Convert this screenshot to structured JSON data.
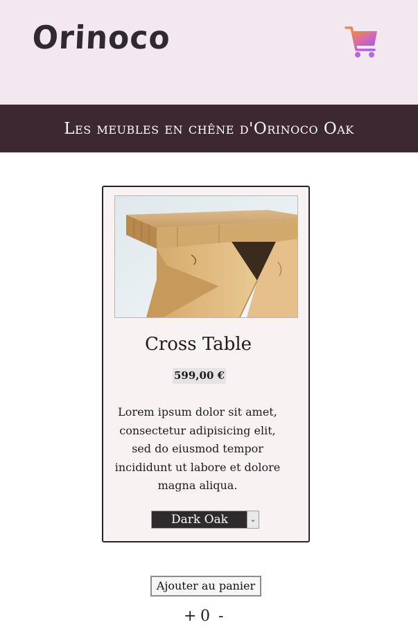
{
  "header": {
    "logo_text": "Orinoco",
    "cart_icon": "shopping-cart-icon",
    "background": "#f3e8f0"
  },
  "banner": {
    "text": "Les meubles en chêne d'Orinoco Oak",
    "background": "#3d2832"
  },
  "product": {
    "image_icon": "oak-table-photo",
    "name": "Cross Table",
    "price": "599,00 €",
    "description": "Lorem ipsum dolor sit amet, consectetur adipisicing elit, sed do eiusmod tempor incididunt ut labore et dolore magna aliqua.",
    "varnish_selected": "Dark Oak"
  },
  "actions": {
    "add_to_cart_label": "Ajouter au panier",
    "increment_label": "+",
    "quantity": "0",
    "decrement_label": "-"
  }
}
